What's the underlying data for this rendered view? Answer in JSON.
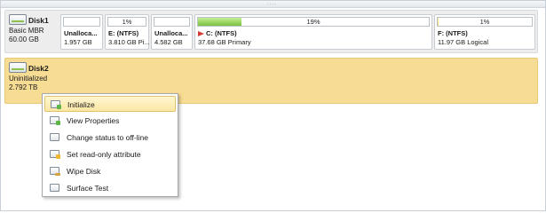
{
  "disks": [
    {
      "name": "Disk1",
      "type": "Basic MBR",
      "size": "60.00 GB",
      "partitions": [
        {
          "name": "Unalloca...",
          "size": "1.957 GB",
          "usage": ""
        },
        {
          "name": "E: (NTFS)",
          "size": "3.810 GB Pi...",
          "usage": "1%",
          "usage_pct": 1
        },
        {
          "name": "Unalloca...",
          "size": "4.582 GB",
          "usage": ""
        },
        {
          "name": "C: (NTFS)",
          "size": "37.68 GB Primary",
          "usage": "19%",
          "usage_pct": 19
        },
        {
          "name": "F: (NTFS)",
          "size": "11.97 GB Logical",
          "usage": "1%",
          "usage_pct": 1
        }
      ]
    },
    {
      "name": "Disk2",
      "status": "Uninitialized",
      "size": "2.792 TB"
    }
  ],
  "context_menu": {
    "items": [
      {
        "label": "Initialize",
        "icon": "initialize-icon",
        "active": true
      },
      {
        "label": "View Properties",
        "icon": "properties-icon"
      },
      {
        "label": "Change status to off-line",
        "icon": "offline-icon"
      },
      {
        "label": "Set read-only attribute",
        "icon": "readonly-icon"
      },
      {
        "label": "Wipe Disk",
        "icon": "wipe-icon"
      },
      {
        "label": "Surface Test",
        "icon": "surface-test-icon"
      }
    ]
  },
  "colors": {
    "disk2_bg": "#f7dc93",
    "usage_green": "#79c23f",
    "usage_yellow": "#f5d55b",
    "menu_highlight": "#fbe7a4"
  }
}
